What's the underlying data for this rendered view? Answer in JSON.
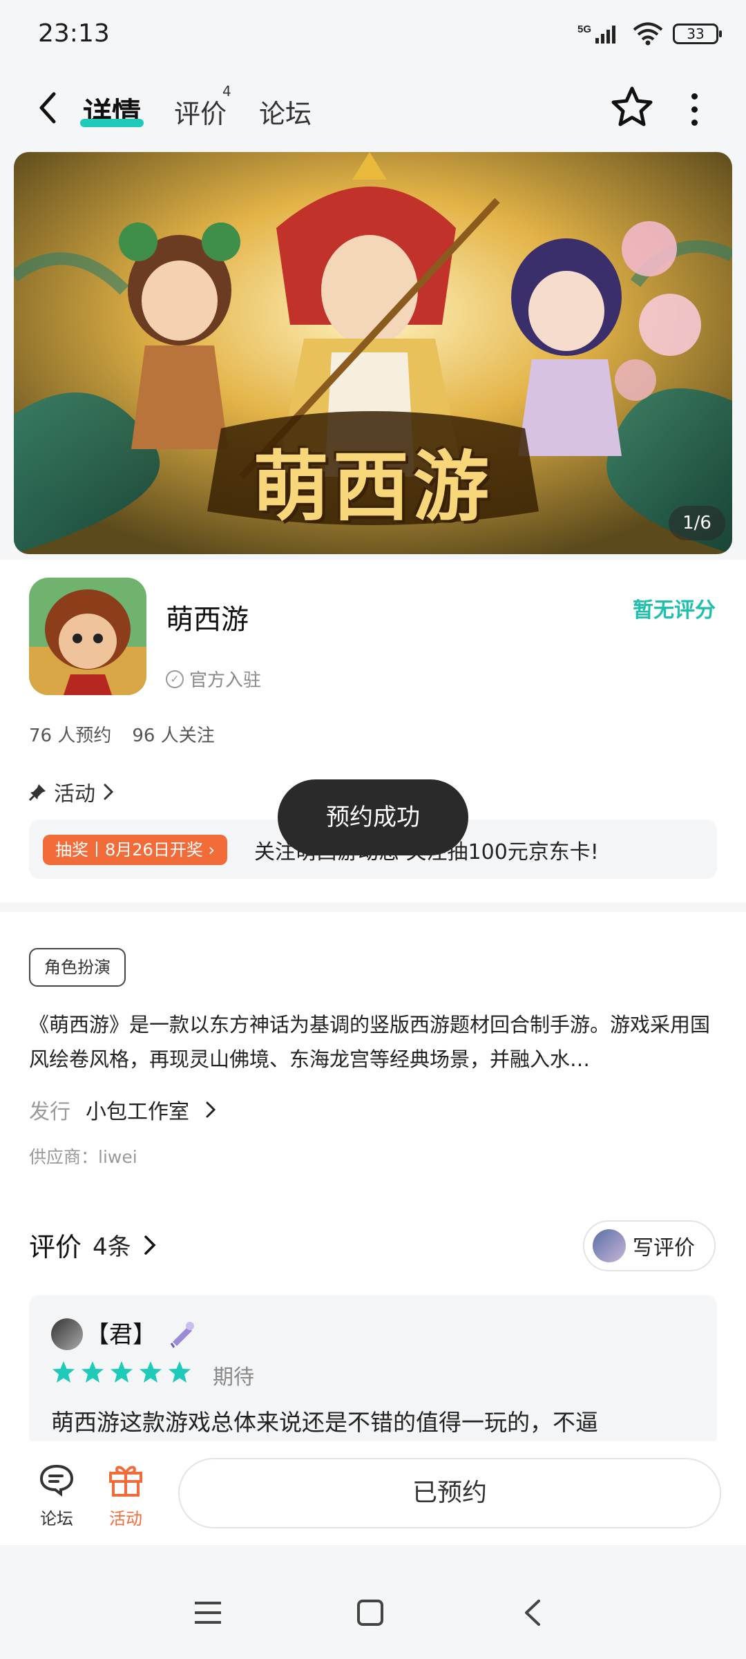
{
  "status_bar": {
    "time": "23:13",
    "network": "5G",
    "battery": "33"
  },
  "nav": {
    "tabs": [
      {
        "label": "详情",
        "active": true
      },
      {
        "label": "评价",
        "badge": "4"
      },
      {
        "label": "论坛"
      }
    ]
  },
  "banner": {
    "title": "萌西游",
    "counter": "1/6"
  },
  "app": {
    "name": "萌西游",
    "official_label": "官方入驻",
    "rating_label": "暂无评分",
    "reservations": "76 人预约",
    "followers": "96 人关注"
  },
  "activity": {
    "header": "活动",
    "tag": "抽奖丨8月26日开奖",
    "text": "关注萌西游动态 关注抽100元京东卡!"
  },
  "toast": "预约成功",
  "details": {
    "genre": "角色扮演",
    "description": "《萌西游》是一款以东方神话为基调的竖版西游题材回合制手游。游戏采用国风绘卷风格，再现灵山佛境、东海龙宫等经典场景，并融入水…",
    "publisher_label": "发行",
    "publisher_name": "小包工作室",
    "supplier": "供应商：liwei"
  },
  "reviews": {
    "title": "评价",
    "count": "4条",
    "write_label": "写评价",
    "items": [
      {
        "user": "【君】",
        "stars": 5,
        "tag": "期待",
        "text": "萌西游这款游戏总体来说还是不错的值得一玩的，不逼"
      }
    ]
  },
  "bottom_bar": {
    "forum_label": "论坛",
    "activity_label": "活动",
    "reserved_label": "已预约"
  },
  "colors": {
    "accent": "#1ecab8",
    "orange": "#f26c3a"
  }
}
